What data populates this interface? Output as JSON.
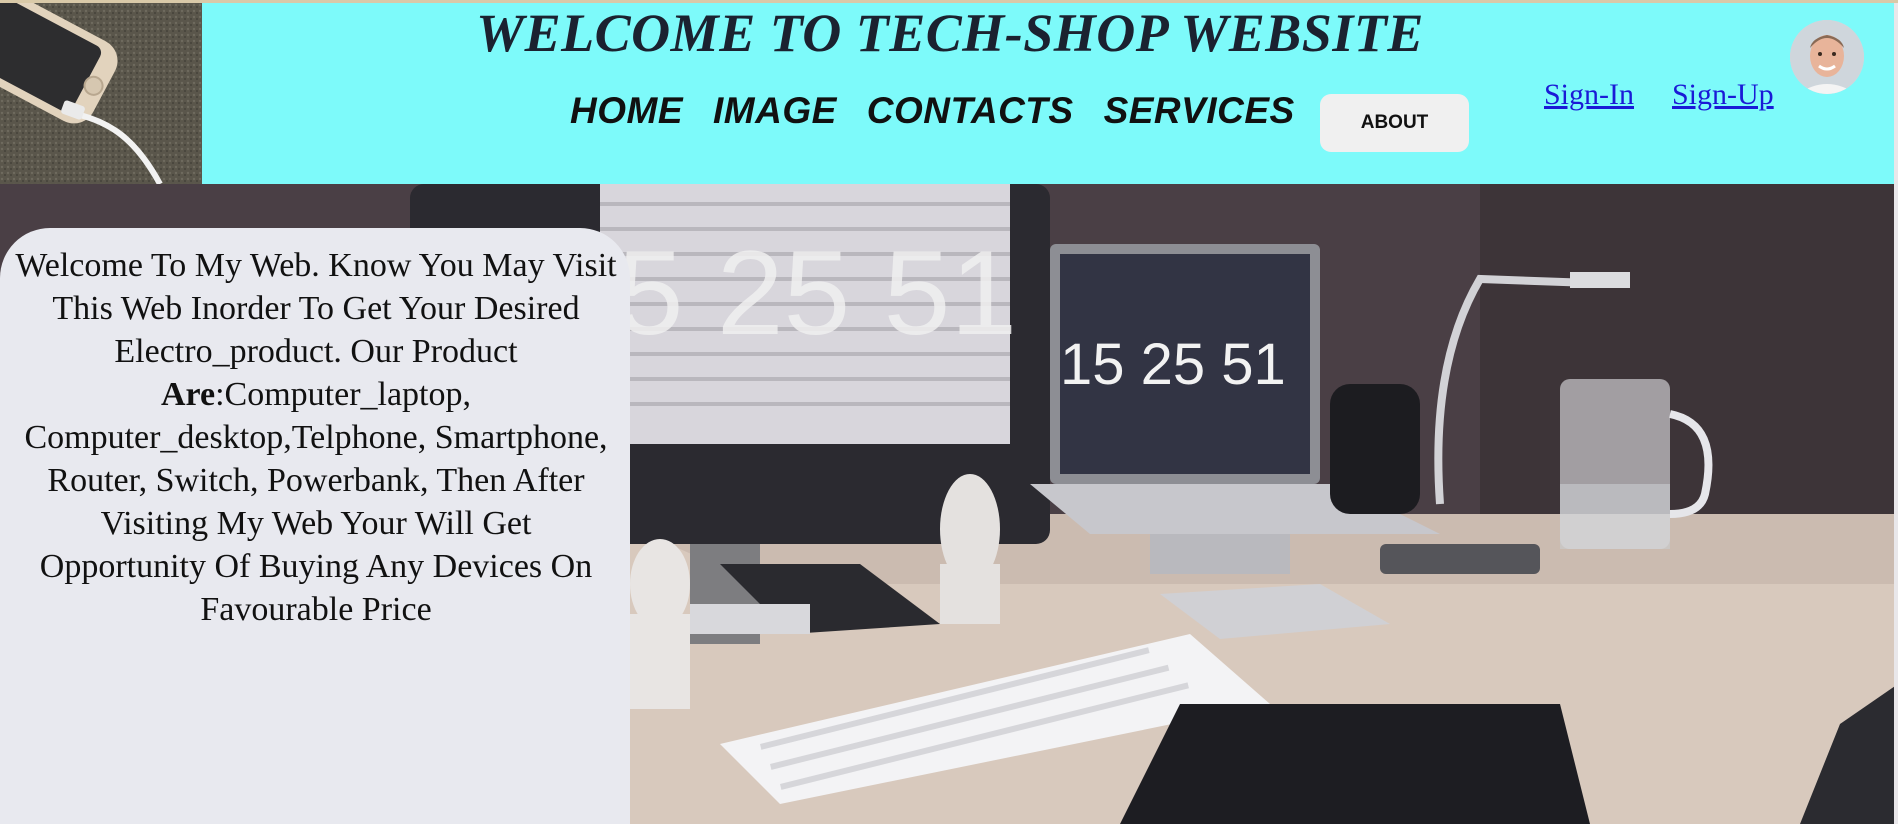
{
  "header": {
    "title": "WELCOME TO TECH-SHOP WEBSITE",
    "background": "#7dfafa",
    "nav": [
      {
        "label": "HOME"
      },
      {
        "label": "IMAGE"
      },
      {
        "label": "CONTACTS"
      },
      {
        "label": "SERVICES"
      }
    ],
    "about_label": "ABOUT",
    "sign_in": "Sign-In",
    "sign_up": "Sign-Up",
    "link_color": "#1a1ad6"
  },
  "hero": {
    "clock_text": "15 25 51",
    "wall_clock_text": "15 25 51"
  },
  "info": {
    "text_before": "Welcome To My Web. Know You May Visit This Web Inorder To Get Your Desired Electro_product. Our Product ",
    "bold_word": "Are",
    "text_after": ":Computer_laptop, Computer_desktop,Telphone, Smartphone, Router, Switch, Powerbank, Then After Visiting My Web Your Will Get Opportunity Of Buying Any Devices On Favourable Price"
  }
}
